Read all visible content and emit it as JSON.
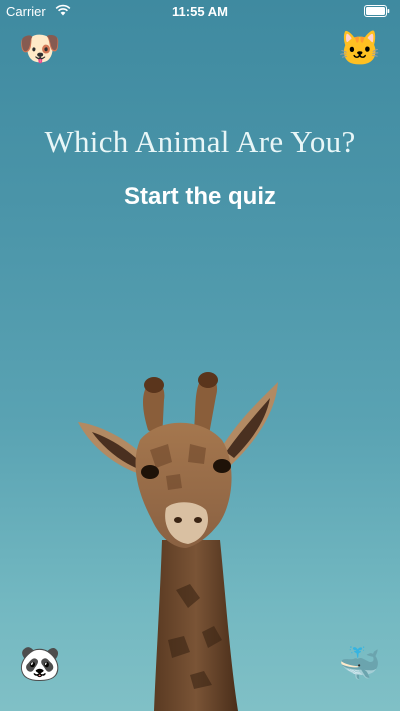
{
  "status_bar": {
    "carrier": "Carrier",
    "time": "11:55 AM"
  },
  "corner_buttons": {
    "top_left": "🐶",
    "top_right": "🐱",
    "bottom_left": "🐼",
    "bottom_right": "🐳"
  },
  "header": {
    "title": "Which Animal Are You?",
    "start_label": "Start the quiz"
  },
  "background": {
    "image_subject": "giraffe-photo",
    "sky_color": "#4b95a9"
  }
}
